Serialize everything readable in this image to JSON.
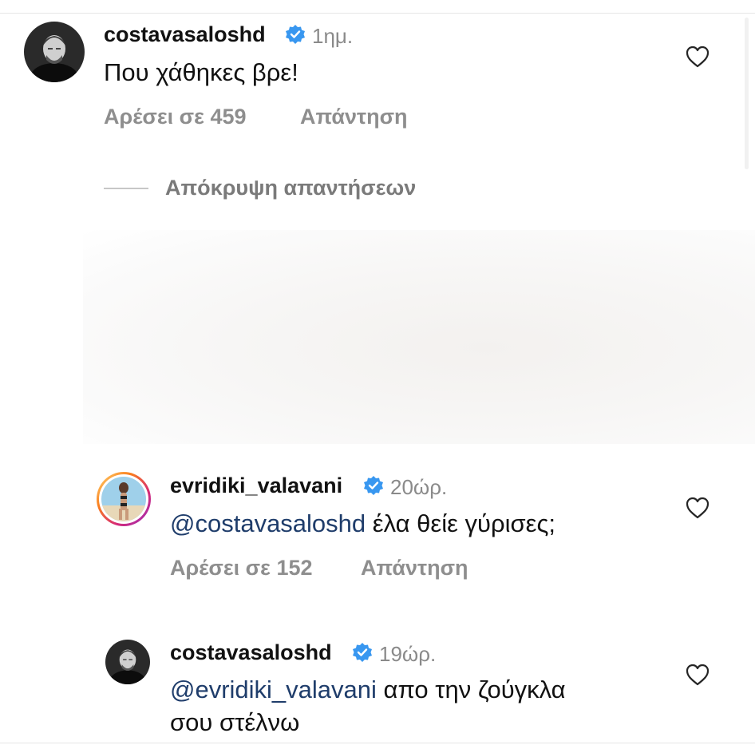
{
  "comments": [
    {
      "username": "costavasaloshd",
      "time": "1ημ.",
      "text": "Που χάθηκες βρε!",
      "likes": "Αρέσει σε 459",
      "reply": "Απάντηση"
    },
    {
      "username": "evridiki_valavani",
      "time": "20ώρ.",
      "mention": "@costavasaloshd",
      "text": " έλα θείε γύρισες;",
      "likes": "Αρέσει σε 152",
      "reply": "Απάντηση"
    },
    {
      "username": "costavasaloshd",
      "time": "19ώρ.",
      "mention": "@evridiki_valavani",
      "text_line1": " απο την ζούγκλα",
      "text_line2": "σου στέλνω"
    }
  ],
  "hide_replies_label": "Απόκρυψη απαντήσεων",
  "colors": {
    "verified": "#3897f0",
    "mention": "#1f3d6b",
    "meta": "#8e8e8e"
  },
  "icons": {
    "verified": "verified-badge-icon",
    "like": "heart-outline-icon"
  }
}
